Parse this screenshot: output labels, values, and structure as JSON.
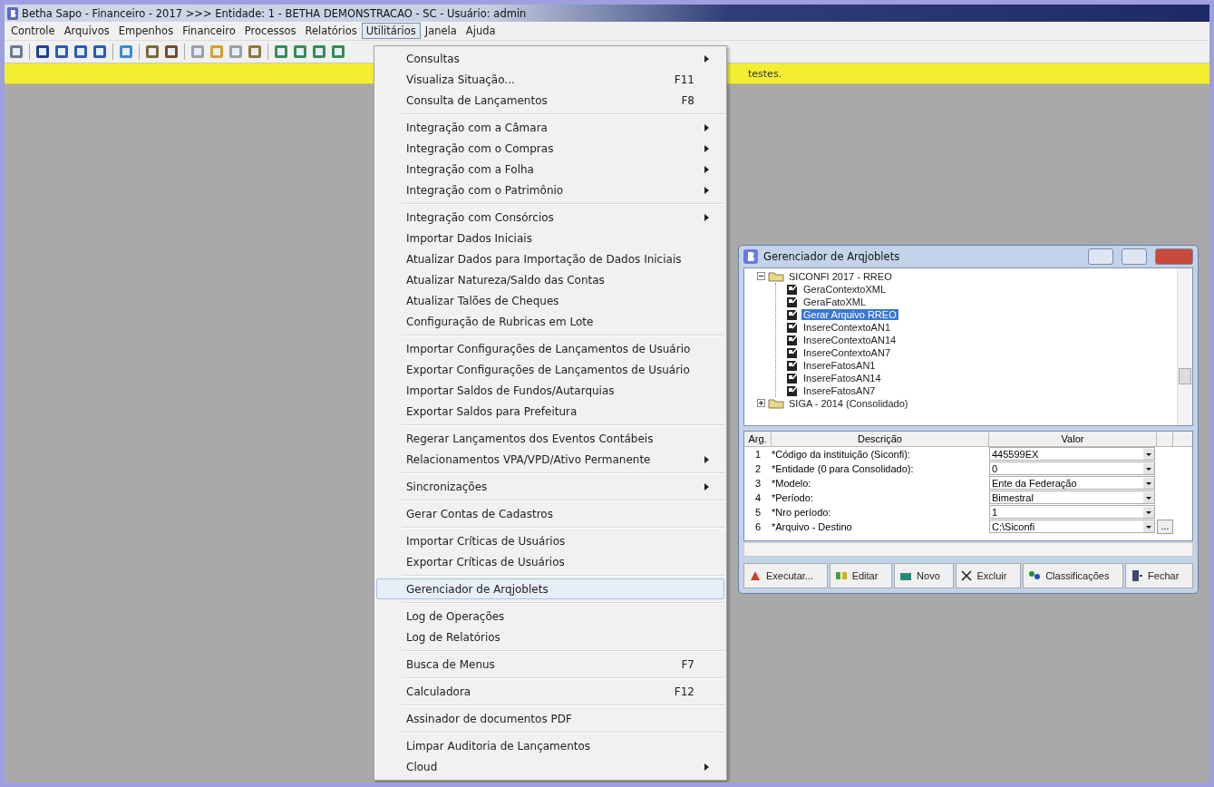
{
  "window": {
    "title": "Betha Sapo - Financeiro - 2017 >>> Entidade: 1 - BETHA DEMONSTRACAO - SC - Usuário: admin"
  },
  "menubar": [
    {
      "label": "Controle",
      "selected": false
    },
    {
      "label": "Arquivos",
      "selected": false
    },
    {
      "label": "Empenhos",
      "selected": false
    },
    {
      "label": "Financeiro",
      "selected": false
    },
    {
      "label": "Processos",
      "selected": false
    },
    {
      "label": "Relatórios",
      "selected": false
    },
    {
      "label": "Utilitários",
      "selected": true
    },
    {
      "label": "Janela",
      "selected": false
    },
    {
      "label": "Ajuda",
      "selected": false
    }
  ],
  "notice": {
    "text": "testes."
  },
  "menu": [
    {
      "kind": "item",
      "label": "Consultas",
      "submenu": true,
      "selected": false
    },
    {
      "kind": "item",
      "label": "Visualiza Situação...",
      "shortcut": "F11",
      "submenu": false,
      "selected": false
    },
    {
      "kind": "item",
      "label": "Consulta de Lançamentos",
      "shortcut": "F8",
      "submenu": false,
      "selected": false
    },
    {
      "kind": "separator"
    },
    {
      "kind": "item",
      "label": "Integração com a Câmara",
      "submenu": true,
      "selected": false
    },
    {
      "kind": "item",
      "label": "Integração com o Compras",
      "submenu": true,
      "selected": false
    },
    {
      "kind": "item",
      "label": "Integração com a Folha",
      "submenu": true,
      "selected": false
    },
    {
      "kind": "item",
      "label": "Integração com o Patrimônio",
      "submenu": true,
      "selected": false
    },
    {
      "kind": "separator"
    },
    {
      "kind": "item",
      "label": "Integração com Consórcios",
      "submenu": true,
      "selected": false
    },
    {
      "kind": "item",
      "label": "Importar Dados Iniciais",
      "submenu": false,
      "selected": false
    },
    {
      "kind": "item",
      "label": "Atualizar Dados para Importação de Dados Iniciais",
      "submenu": false,
      "selected": false
    },
    {
      "kind": "item",
      "label": "Atualizar Natureza/Saldo das Contas",
      "submenu": false,
      "selected": false
    },
    {
      "kind": "item",
      "label": "Atualizar Talões de Cheques",
      "submenu": false,
      "selected": false
    },
    {
      "kind": "item",
      "label": "Configuração de Rubricas em Lote",
      "submenu": false,
      "selected": false
    },
    {
      "kind": "separator"
    },
    {
      "kind": "item",
      "label": "Importar Configurações de Lançamentos de Usuário",
      "submenu": false,
      "selected": false
    },
    {
      "kind": "item",
      "label": "Exportar Configurações de Lançamentos de Usuário",
      "submenu": false,
      "selected": false
    },
    {
      "kind": "item",
      "label": "Importar Saldos de Fundos/Autarquias",
      "submenu": false,
      "selected": false
    },
    {
      "kind": "item",
      "label": "Exportar Saldos para Prefeitura",
      "submenu": false,
      "selected": false
    },
    {
      "kind": "separator"
    },
    {
      "kind": "item",
      "label": "Regerar Lançamentos dos Eventos Contábeis",
      "submenu": false,
      "selected": false
    },
    {
      "kind": "item",
      "label": "Relacionamentos VPA/VPD/Ativo Permanente",
      "submenu": true,
      "selected": false
    },
    {
      "kind": "separator"
    },
    {
      "kind": "item",
      "label": "Sincronizações",
      "submenu": true,
      "selected": false
    },
    {
      "kind": "separator"
    },
    {
      "kind": "item",
      "label": "Gerar Contas de Cadastros",
      "submenu": false,
      "selected": false
    },
    {
      "kind": "separator"
    },
    {
      "kind": "item",
      "label": "Importar Críticas de Usuários",
      "submenu": false,
      "selected": false
    },
    {
      "kind": "item",
      "label": "Exportar Críticas de Usuários",
      "submenu": false,
      "selected": false
    },
    {
      "kind": "separator"
    },
    {
      "kind": "item",
      "label": "Gerenciador de Arqjoblets",
      "submenu": false,
      "selected": true
    },
    {
      "kind": "separator"
    },
    {
      "kind": "item",
      "label": "Log de Operações",
      "submenu": false,
      "selected": false
    },
    {
      "kind": "item",
      "label": "Log de Relatórios",
      "submenu": false,
      "selected": false
    },
    {
      "kind": "separator"
    },
    {
      "kind": "item",
      "label": "Busca de Menus",
      "shortcut": "F7",
      "submenu": false,
      "selected": false
    },
    {
      "kind": "separator"
    },
    {
      "kind": "item",
      "label": "Calculadora",
      "shortcut": "F12",
      "submenu": false,
      "selected": false
    },
    {
      "kind": "separator"
    },
    {
      "kind": "item",
      "label": "Assinador de documentos PDF",
      "submenu": false,
      "selected": false
    },
    {
      "kind": "separator"
    },
    {
      "kind": "item",
      "label": "Limpar Auditoria de Lançamentos",
      "submenu": false,
      "selected": false
    },
    {
      "kind": "item",
      "label": "Cloud",
      "submenu": true,
      "selected": false
    }
  ],
  "dialog": {
    "title": "Gerenciador de Arqjoblets",
    "tree": [
      {
        "label": "SICONFI 2017 - RREO",
        "expanded": true,
        "children": [
          {
            "label": "GeraContextoXML",
            "selected": false
          },
          {
            "label": "GeraFatoXML",
            "selected": false
          },
          {
            "label": "Gerar Arquivo RREO",
            "selected": true
          },
          {
            "label": "InsereContextoAN1",
            "selected": false
          },
          {
            "label": "InsereContextoAN14",
            "selected": false
          },
          {
            "label": "InsereContextoAN7",
            "selected": false
          },
          {
            "label": "InsereFatosAN1",
            "selected": false
          },
          {
            "label": "InsereFatosAN14",
            "selected": false
          },
          {
            "label": "InsereFatosAN7",
            "selected": false
          }
        ]
      },
      {
        "label": "SIGA - 2014 (Consolidado)",
        "expanded": false
      }
    ],
    "columns": [
      "Arg.",
      "Descrição",
      "Valor"
    ],
    "rows": [
      {
        "arg": "1",
        "description": "*Código da instituição (Siconfi):",
        "value": "445599EX",
        "browse": false
      },
      {
        "arg": "2",
        "description": "*Entidade (0 para Consolidado):",
        "value": "0",
        "browse": false
      },
      {
        "arg": "3",
        "description": "*Modelo:",
        "value": "Ente da Federação",
        "browse": false
      },
      {
        "arg": "4",
        "description": "*Período:",
        "value": "Bimestral",
        "browse": false
      },
      {
        "arg": "5",
        "description": "*Nro período:",
        "value": "1",
        "browse": false
      },
      {
        "arg": "6",
        "description": "*Arquivo - Destino",
        "value": "C:\\Siconfi",
        "browse": true,
        "browse_label": "..."
      }
    ],
    "buttons": [
      {
        "label": "Executar...",
        "kind": "run"
      },
      {
        "label": "Editar",
        "kind": "edit"
      },
      {
        "label": "Novo",
        "kind": "new"
      },
      {
        "label": "Excluir",
        "kind": "delete"
      },
      {
        "label": "Classificações",
        "kind": "classify"
      },
      {
        "label": "Fechar",
        "kind": "close"
      }
    ]
  }
}
